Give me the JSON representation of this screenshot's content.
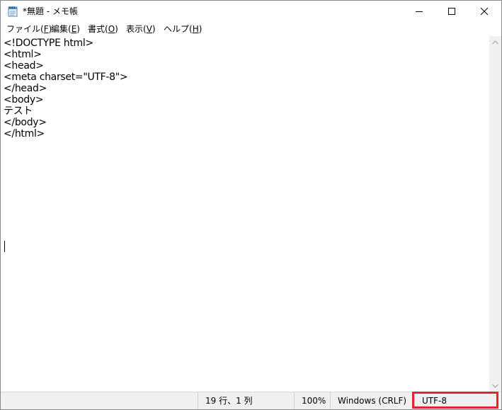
{
  "window": {
    "title": "*無題 - メモ帳",
    "icon": "notepad-icon",
    "controls": {
      "minimize_icon": "minimize-icon",
      "maximize_icon": "maximize-icon",
      "close_icon": "close-icon"
    }
  },
  "menu": {
    "items": [
      {
        "label": "ファイル(",
        "accel": "F",
        "close": ")"
      },
      {
        "label": "編集(",
        "accel": "E",
        "close": ")"
      },
      {
        "label": "書式(",
        "accel": "O",
        "close": ")"
      },
      {
        "label": "表示(",
        "accel": "V",
        "close": ")"
      },
      {
        "label": "ヘルプ(",
        "accel": "H",
        "close": ")"
      }
    ]
  },
  "editor": {
    "lines": [
      "<!DOCTYPE html>",
      "<html>",
      "<head>",
      "<meta charset=\"UTF-8\">",
      "</head>",
      "<body>",
      "テスト",
      "</body>",
      "</html>"
    ]
  },
  "status": {
    "position": "19 行、1 列",
    "zoom": "100%",
    "line_ending": "Windows (CRLF)",
    "encoding": "UTF-8"
  },
  "colors": {
    "highlight": "#e0272c",
    "statusbar": "#f0f0f0"
  }
}
